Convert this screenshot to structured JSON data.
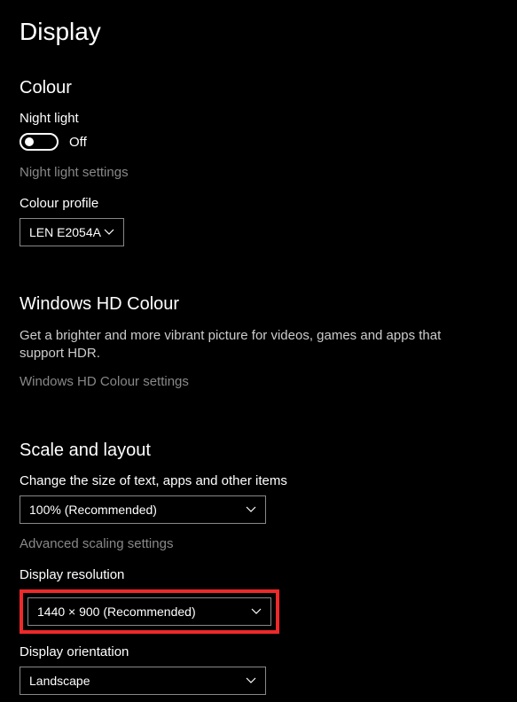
{
  "pageTitle": "Display",
  "colour": {
    "heading": "Colour",
    "nightLightLabel": "Night light",
    "nightLightState": "Off",
    "nightLightSettingsLink": "Night light settings",
    "colourProfileLabel": "Colour profile",
    "colourProfileValue": "LEN E2054A"
  },
  "hdColour": {
    "heading": "Windows HD Colour",
    "description": "Get a brighter and more vibrant picture for videos, games and apps that support HDR.",
    "settingsLink": "Windows HD Colour settings"
  },
  "scaleLayout": {
    "heading": "Scale and layout",
    "scaleLabel": "Change the size of text, apps and other items",
    "scaleValue": "100% (Recommended)",
    "advancedScalingLink": "Advanced scaling settings",
    "resolutionLabel": "Display resolution",
    "resolutionValue": "1440 × 900 (Recommended)",
    "orientationLabel": "Display orientation",
    "orientationValue": "Landscape"
  }
}
